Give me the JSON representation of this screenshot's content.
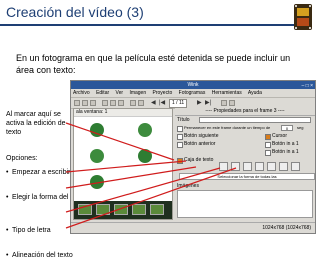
{
  "slide": {
    "title": "Creación del vídeo (3)",
    "intro": "En un fotograma en que la película esté detenida se puede incluir un área con texto:",
    "side_note": "Al marcar aquí se activa la edición de texto",
    "options_label": "Opciones:",
    "bullets": [
      "Empezar a escribir",
      "Elegir la forma del área",
      "Tipo de letra",
      "Alineación del texto"
    ],
    "accent_color": "#1e3f74",
    "arrow_color": "#d01c1c"
  },
  "app": {
    "title": "Wink",
    "menu": [
      "Archivo",
      "Editar",
      "Ver",
      "Imagen",
      "Proyecto",
      "Fotogramas",
      "Herramientas",
      "Ayuda"
    ],
    "counter": "1 / 11",
    "left_header": "ala ventana: 1",
    "properties_header": "---- Propiedades para el frame 3 ----",
    "rows": {
      "title_label": "Título",
      "pause_label": "Permanecer en este frame durante un tiempo de",
      "pause_value": "0",
      "pause_unit": "seg",
      "next_button": "Botón siguiente",
      "prev_button": "Botón anterior",
      "cursor": "Cursor",
      "button_left": "Botón in a 1",
      "button_right": "Botón in a 1",
      "text_box": "Caja de texto",
      "color_bar": "Seleccionar la forma de todas las",
      "images": "Imágenes"
    },
    "status_right": "1024x768 (1024x768)"
  }
}
